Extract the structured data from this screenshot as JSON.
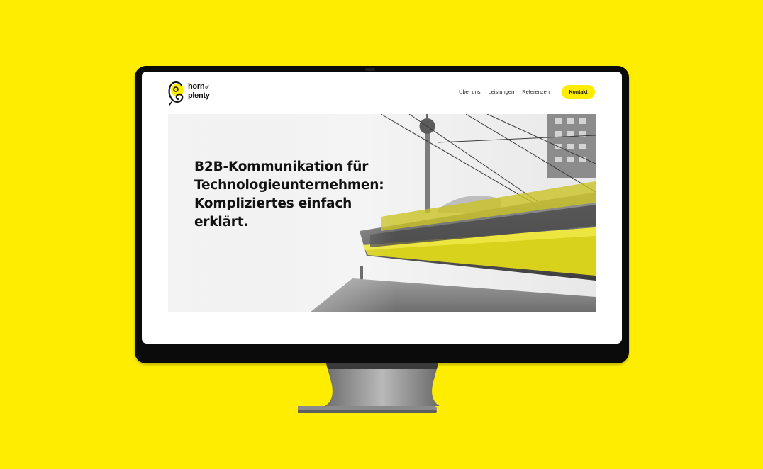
{
  "brand": {
    "logo_line1": "horn",
    "logo_of": "of",
    "logo_line2": "plenty",
    "accent_color": "#FFED00"
  },
  "nav": {
    "items": [
      {
        "label": "Über uns"
      },
      {
        "label": "Leistungen"
      },
      {
        "label": "Referenzen"
      }
    ],
    "cta_label": "Kontakt"
  },
  "hero": {
    "title": "B2B-Kommunikation für Technologieunternehmen: Kompliziertes einfach erklärt.",
    "image": "black-and-white Berlin TV tower with yellow tram in motion"
  },
  "icons": [
    "horn-of-plenty-logo-icon"
  ]
}
